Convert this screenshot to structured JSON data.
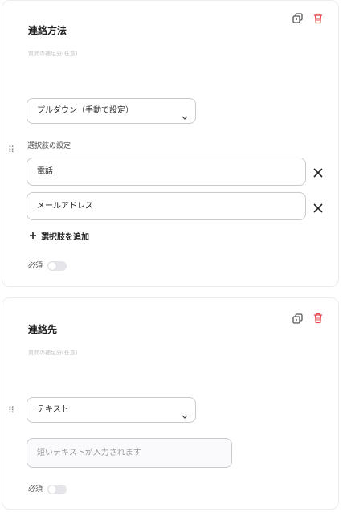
{
  "colors": {
    "accent_danger": "#e5484d",
    "border": "#c9c9cf",
    "muted_text": "#c4c4c8"
  },
  "questions": [
    {
      "title": "連絡方法",
      "supplement_placeholder": "質問の補足分(任意)",
      "type_select": "プルダウン（手動で設定）",
      "options_label": "選択肢の設定",
      "options": [
        "電話",
        "メールアドレス"
      ],
      "add_option_label": "選択肢を追加",
      "required_label": "必須",
      "required": false
    },
    {
      "title": "連絡先",
      "supplement_placeholder": "質問の補足分(任意)",
      "type_select": "テキスト",
      "answer_preview": "短いテキストが入力されます",
      "required_label": "必須",
      "required": false
    }
  ],
  "icons": {
    "duplicate": "duplicate-icon",
    "delete": "trash-icon",
    "drag": "drag-handle-icon",
    "remove_option": "close-icon",
    "add": "plus-icon",
    "dropdown": "chevron-down-icon"
  }
}
